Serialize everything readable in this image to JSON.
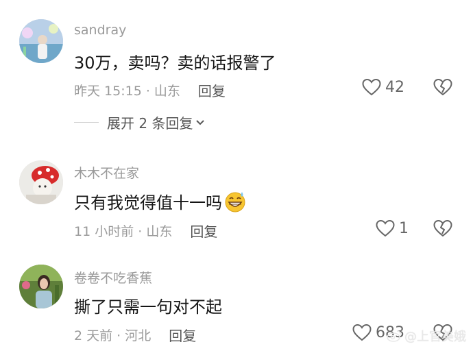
{
  "comments": [
    {
      "username": "sandray",
      "text": "30万，卖吗？卖的话报警了",
      "time": "昨天 15:15 · 山东",
      "reply_label": "回复",
      "likes": "42",
      "expand_label": "展开 2 条回复"
    },
    {
      "username": "木木不在家",
      "text": "只有我觉得值十一吗",
      "time": "11 小时前 · 山东",
      "reply_label": "回复",
      "likes": "1"
    },
    {
      "username": "卷卷不吃香蕉",
      "text": "撕了只需一句对不起",
      "time": "2 天前 · 河北",
      "reply_label": "回复",
      "likes": "683"
    }
  ],
  "watermark": "@上官美娥"
}
